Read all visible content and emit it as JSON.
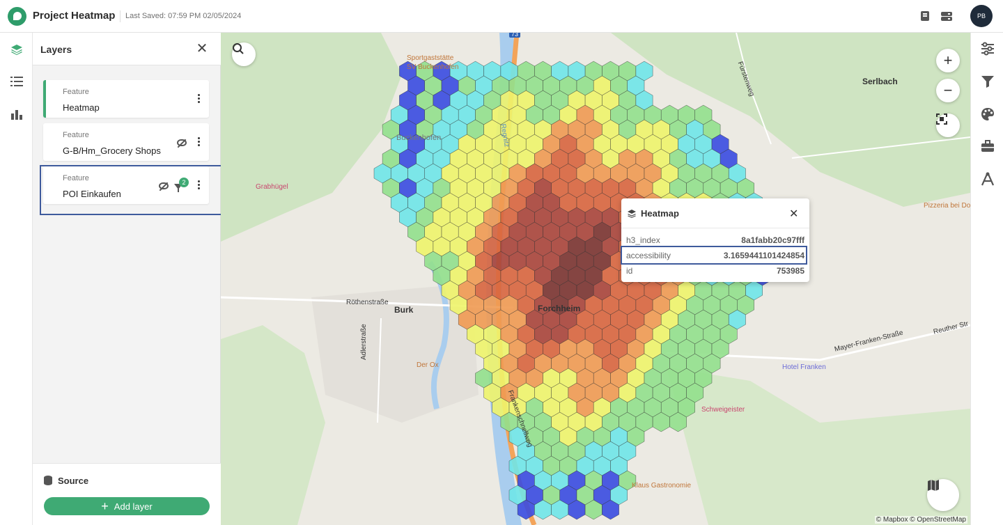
{
  "header": {
    "title": "Project Heatmap",
    "last_saved": "Last Saved: 07:59 PM 02/05/2024",
    "avatar_initials": "PB"
  },
  "layers_panel": {
    "title": "Layers",
    "layers": [
      {
        "type": "Feature",
        "name": "Heatmap"
      },
      {
        "type": "Feature",
        "name": "G-B/Hm_Grocery Shops"
      },
      {
        "type": "Feature",
        "name": "POI Einkaufen",
        "filter_count": "2"
      }
    ],
    "source_label": "Source",
    "add_layer_label": "Add layer"
  },
  "popup": {
    "title": "Heatmap",
    "rows": [
      {
        "key": "h3_index",
        "value": "8a1fabb20c97fff"
      },
      {
        "key": "accessibility",
        "value": "3.1659441101424854"
      },
      {
        "key": "id",
        "value": "753985"
      }
    ]
  },
  "map": {
    "labels": {
      "serlbach": "Serlbach",
      "sportgaststaette": "Sportgaststätte",
      "sv_buckenhofen": "SV Buckenhofen",
      "buckenhofen": "Buckenhofen",
      "grabhuegel": "Grabhügel",
      "burk": "Burk",
      "roethenstrasse": "Röthenstraße",
      "forchheim": "Forchheim",
      "der_ox": "Der Ox",
      "adlerstrasse": "Adlerstraße",
      "frankenschnellweg": "Frankenschnellweg",
      "regnitz": "Regnitz",
      "fuerstenweg": "Fürstenweg",
      "pizzeria": "Pizzeria bei Doro",
      "hotel_franken": "Hotel Franken",
      "mayer_franken": "Mayer-Franken-Straße",
      "reuther": "Reuther Str",
      "gastronomie": "Klaus Gastronomie",
      "schweigeister": "Schweigeister",
      "highway": "73"
    },
    "attribution": "© Mapbox © OpenStreetMap"
  },
  "colors": {
    "accent": "#3faa74",
    "highlight": "#3e5a9c",
    "heat_scale": [
      "#3a4be0",
      "#6fe6e8",
      "#92e08c",
      "#eef46a",
      "#f09a52",
      "#d8653e",
      "#a8443a",
      "#7a3330"
    ]
  }
}
